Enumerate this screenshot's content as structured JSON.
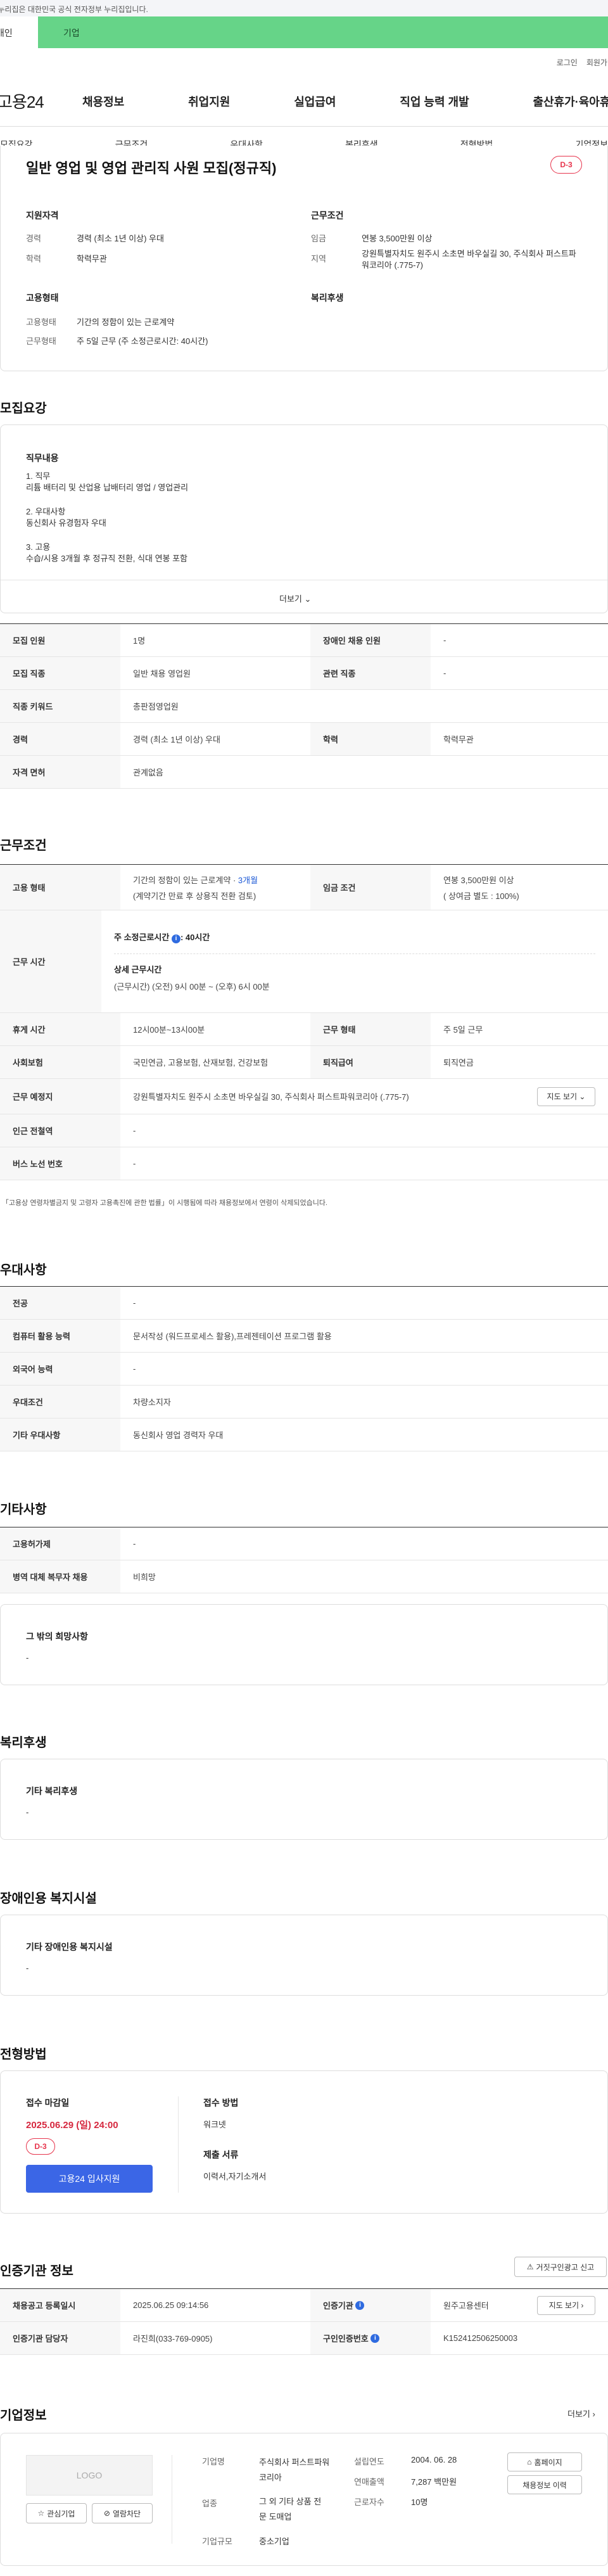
{
  "gov_banner": "이 누리집은 대한민국 공식 전자정부 누리집입니다.",
  "member_tabs": {
    "individual": "개인",
    "business": "기업"
  },
  "util": {
    "login": "로그인",
    "join": "회원가입"
  },
  "logo": "고용24",
  "gnb": [
    "채용정보",
    "취업지원",
    "실업급여",
    "직업 능력 개발",
    "출산휴가·육아휴직"
  ],
  "anchors": [
    "모집요강",
    "근무조건",
    "우대사항",
    "복리후생",
    "전형방법",
    "기업정보"
  ],
  "summary": {
    "title": "일반 영업 및 영업 관리직 사원 모집(정규직)",
    "dday": "D-3",
    "qual": {
      "heading": "지원자격",
      "career_label": "경력",
      "career": "경력 (최소 1년 이상) 우대",
      "edu_label": "학력",
      "edu": "학력무관"
    },
    "cond": {
      "heading": "근무조건",
      "wage_label": "임금",
      "wage": "연봉 3,500만원 이상",
      "area_label": "지역",
      "area": "강원특별자치도 원주시 소초면 바우실길 30, 주식회사 퍼스트파워코리아 (.775-7)"
    },
    "emp": {
      "heading": "고용형태",
      "type_label": "고용형태",
      "type": "기간의 정함이 있는 근로계약",
      "hours_label": "근무형태",
      "hours": "주 5일 근무 (주 소정근로시간: 40시간)"
    },
    "welfare": {
      "heading": "복리후생"
    }
  },
  "recruit": {
    "title": "모집요강",
    "duty_heading": "직무내용",
    "duty_lines": [
      "1. 직무",
      " 리튬 배터리 및 산업용 납배터리  영업 / 영업관리",
      "2. 우대사항",
      " 동신회사 유경험자 우대",
      "3. 고용",
      " 수습/시용 3개월 후 정규직 전환, 식대 연봉 포함"
    ],
    "more": "더보기",
    "rows": [
      {
        "th": "모집 인원",
        "td": "1명",
        "th2": "장애인 채용 인원",
        "td2": "-"
      },
      {
        "th": "모집 직종",
        "td": "일반 채용 영업원",
        "th2": "관련 직종",
        "td2": "-"
      },
      {
        "th": "직종 키워드",
        "td": "총판점영업원"
      },
      {
        "th": "경력",
        "td": "경력 (최소 1년 이상) 우대",
        "th2": "학력",
        "td2": "학력무관"
      },
      {
        "th": "자격 면허",
        "td": "관계없음"
      }
    ]
  },
  "work": {
    "title": "근무조건",
    "emp_th": "고용 형태",
    "emp_td1": "기간의 정함이 있는 근로계약 · ",
    "emp_td1_hl": "3개월",
    "emp_td2": "(계약기간 만료 후 상용직 전환 검토)",
    "wage_th": "임금 조건",
    "wage_td1": "연봉 3,500만원 이상",
    "wage_td2": "( 상여금 별도 : 100%)",
    "time_th": "근무 시간",
    "time_t1": "주 소정근로시간",
    "time_t1_val": ": 40시간",
    "time_t2": "상세 근무시간",
    "time_t3": "(근무시간) (오전) 9시 00분 ~ (오후) 6시 00분",
    "rest_th": "휴게 시간",
    "rest_td": "12시00분~13시00분",
    "form_th": "근무 형태",
    "form_td": "주 5일 근무",
    "ins_th": "사회보험",
    "ins_td": "국민연금, 고용보험, 산재보험, 건강보험",
    "ret_th": "퇴직급여",
    "ret_td": "퇴직연금",
    "place_th": "근무 예정지",
    "place_td": "강원특별자치도 원주시 소초면 바우실길 30, 주식회사 퍼스트파워코리아 (.775-7)",
    "map_btn": "지도 보기",
    "station_th": "인근 전철역",
    "station_td": "-",
    "bus_th": "버스 노선 번호",
    "bus_td": "-",
    "note": "「고용상 연령차별금지 및 고령자 고용촉진에 관한 법률」이 시행됨에 따라 채용정보에서 연령이 삭제되었습니다."
  },
  "pref": {
    "title": "우대사항",
    "rows": [
      {
        "th": "전공",
        "td": "-"
      },
      {
        "th": "컴퓨터 활용 능력",
        "td": "문서작성 (워드프로세스 활용),프레젠테이션 프로그램 활용"
      },
      {
        "th": "외국어 능력",
        "td": "-"
      },
      {
        "th": "우대조건",
        "td": "차량소지자"
      },
      {
        "th": "기타 우대사항",
        "td": "동신회사 영업 경력자 우대"
      }
    ]
  },
  "etc": {
    "title": "기타사항",
    "rows": [
      {
        "th": "고용허가제",
        "td": "-"
      },
      {
        "th": "병역 대체 복무자 채용",
        "td": "비희망"
      }
    ],
    "hope_heading": "그 밖의 희망사항",
    "hope_value": "-"
  },
  "benefit": {
    "title": "복리후생",
    "heading": "기타 복리후생",
    "value": "-"
  },
  "disabled": {
    "title": "장애인용 복지시설",
    "heading": "기타 장애인용 복지시설",
    "value": "-"
  },
  "selection": {
    "title": "전형방법",
    "deadline_label": "접수 마감일",
    "deadline": "2025.06.29 (일) 24:00",
    "dday": "D-3",
    "apply_btn": "고용24 입사지원",
    "method_label": "접수 방법",
    "method": "워크넷",
    "docs_label": "제출 서류",
    "docs": "이력서,자기소개서"
  },
  "cert": {
    "title": "인증기관 정보",
    "report_btn": "거짓구인광고 신고",
    "reg_th": "채용공고 등록일시",
    "reg_td": "2025.06.25 09:14:56",
    "org_th": "인증기관",
    "org_td": "원주고용센터",
    "map_btn": "지도 보기",
    "mgr_th": "인증기관 담당자",
    "mgr_td": "라진희(033-769-0905)",
    "no_th": "구인인증번호",
    "no_td": "K152412506250003"
  },
  "company": {
    "title": "기업정보",
    "more": "더보기",
    "logo_placeholder": "LOGO",
    "fav_btn": "관심기업",
    "block_btn": "열람차단",
    "name_label": "기업명",
    "name": "주식회사 퍼스트파워코리아",
    "industry_label": "업종",
    "industry": "그 외 기타 상품 전문 도매업",
    "scale_label": "기업규모",
    "scale": "중소기업",
    "founded_label": "설립연도",
    "founded": "2004. 06. 28",
    "sales_label": "연매출액",
    "sales": "7,287 백만원",
    "staff_label": "근로자수",
    "staff": "10명",
    "homepage_btn": "홈페이지",
    "jobs_btn": "채용정보 이력"
  }
}
